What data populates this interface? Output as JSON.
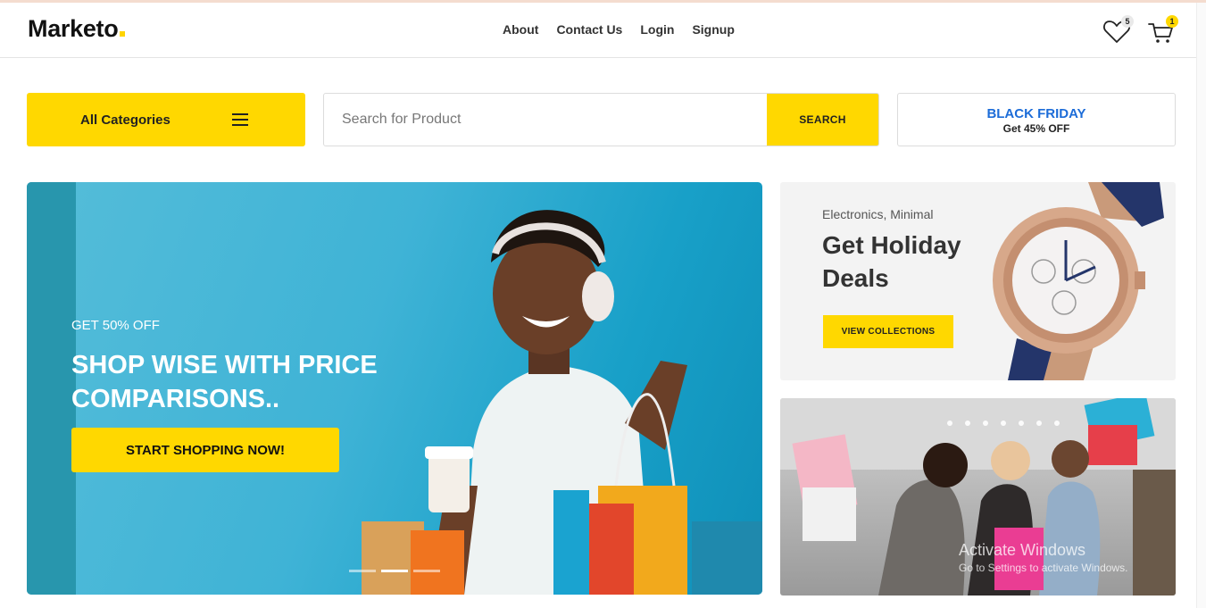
{
  "header": {
    "logo": "Marketo",
    "nav": [
      "About",
      "Contact Us",
      "Login",
      "Signup"
    ],
    "wishlist_count": "5",
    "cart_count": "1",
    "icons": {
      "wishlist": "heart-icon",
      "cart": "cart-icon"
    }
  },
  "toolbar": {
    "categories_label": "All Categories",
    "search_placeholder": "Search for Product",
    "search_button": "SEARCH",
    "promo_title": "BLACK FRIDAY",
    "promo_sub": "Get 45% OFF"
  },
  "hero": {
    "subtitle": "GET 50% OFF",
    "title": "SHOP WISE WITH PRICE COMPARISONS..",
    "cta": "START SHOPPING NOW!",
    "slides": 3,
    "active_slide": 2
  },
  "card_watch": {
    "tag": "Electronics, Minimal",
    "title": "Get Holiday Deals",
    "button": "VIEW COLLECTIONS"
  },
  "overlay": {
    "line1": "Activate Windows",
    "line2": "Go to Settings to activate Windows."
  },
  "colors": {
    "accent": "#ffd800",
    "promo_blue": "#1c6cd8",
    "hero_bg": "#3fb3d6"
  }
}
